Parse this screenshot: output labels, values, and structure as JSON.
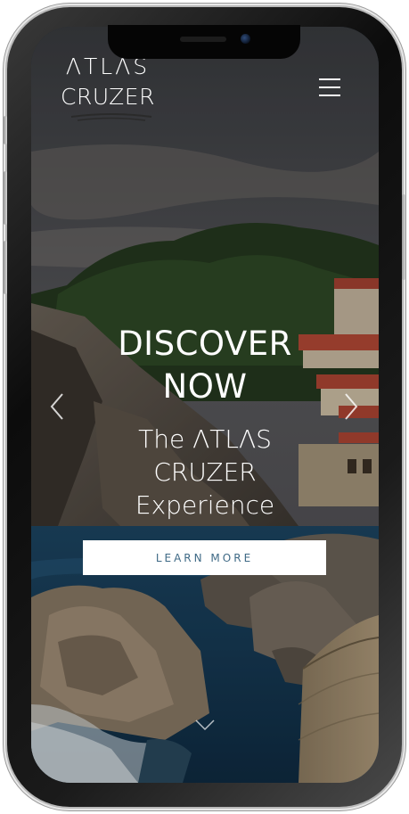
{
  "header": {
    "logo_line1": "ΛTLΛS",
    "logo_line2": "CRUZER",
    "menu_icon": "hamburger-icon"
  },
  "hero": {
    "title_line1": "DISCOVER",
    "title_line2": "NOW",
    "subtitle_line1": "The ΛTLΛS",
    "subtitle_line2": "CRUZER",
    "subtitle_line3": "Experience",
    "cta_label": "LEARN MORE",
    "prev_icon": "chevron-left-icon",
    "next_icon": "chevron-right-icon",
    "scroll_icon": "chevron-down-icon"
  },
  "colors": {
    "cta_background": "#ffffff",
    "cta_text": "#3f6a86",
    "overlay_text": "#ffffff",
    "phone_frame": "#0c0c0c"
  }
}
